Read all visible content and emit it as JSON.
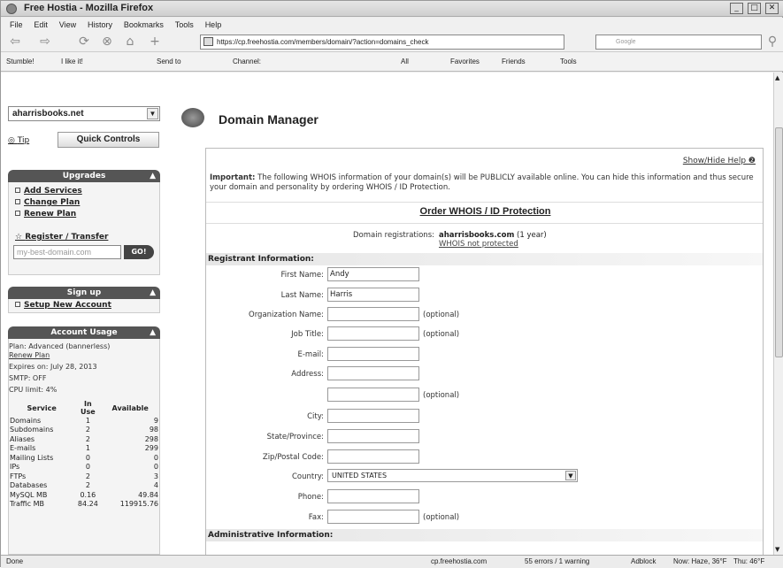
{
  "window": {
    "title": "Free Hostia - Mozilla Firefox"
  },
  "menu": [
    "File",
    "Edit",
    "View",
    "History",
    "Bookmarks",
    "Tools",
    "Help"
  ],
  "nav": {
    "url": "https://cp.freehostia.com/members/domain/?action=domains_check",
    "search_placeholder": "Google"
  },
  "toolbar": {
    "stumble": "Stumble!",
    "ilike": "I like it!",
    "sendto": "Send to",
    "channel": "Channel:",
    "all": "All",
    "favorites": "Favorites",
    "friends": "Friends",
    "tools": "Tools"
  },
  "sidebar": {
    "domain": "aharrisbooks.net",
    "tip": "Tip",
    "quick_controls": "Quick Controls",
    "upgrades": {
      "title": "Upgrades",
      "items": [
        "Add Services",
        "Change Plan",
        "Renew Plan"
      ]
    },
    "register": "Register / Transfer",
    "domain_placeholder": "my-best-domain.com",
    "go": "GO!",
    "signup": {
      "title": "Sign up",
      "items": [
        "Setup New Account"
      ]
    },
    "account": {
      "title": "Account Usage",
      "plan": "Plan: Advanced (bannerless)",
      "renew": "Renew Plan",
      "expires": "Expires on: July 28, 2013",
      "smtp": "SMTP: OFF",
      "cpu": "CPU limit: 4%",
      "headers": [
        "Service",
        "In Use",
        "Available"
      ],
      "rows": [
        [
          "Domains",
          "1",
          "9"
        ],
        [
          "Subdomains",
          "2",
          "98"
        ],
        [
          "Aliases",
          "2",
          "298"
        ],
        [
          "E-mails",
          "1",
          "299"
        ],
        [
          "Mailing Lists",
          "0",
          "0"
        ],
        [
          "IPs",
          "0",
          "0"
        ],
        [
          "FTPs",
          "2",
          "3"
        ],
        [
          "Databases",
          "2",
          "4"
        ],
        [
          "MySQL MB",
          "0.16",
          "49.84"
        ],
        [
          "Traffic MB",
          "84.24",
          "119915.76"
        ]
      ]
    }
  },
  "main": {
    "title": "Domain Manager",
    "show_hide_help": "Show/Hide Help",
    "important_bold": "Important:",
    "important_text": " The following WHOIS information of your domain(s) will be PUBLICLY available online. You can hide this information and thus secure your domain and personality by ordering WHOIS / ID Protection.",
    "order_link": "Order WHOIS / ID Protection",
    "registrations_label": "Domain registrations:",
    "registration_domain": "aharrisbooks.com",
    "registration_period": " (1 year)",
    "whois_status": "WHOIS not protected",
    "registrant_section": "Registrant Information:",
    "admin_section": "Administrative Information:",
    "optional": "(optional)",
    "fields": {
      "first_name": {
        "label": "First Name:",
        "value": "Andy"
      },
      "last_name": {
        "label": "Last Name:",
        "value": "Harris"
      },
      "organization": {
        "label": "Organization Name:",
        "value": ""
      },
      "job_title": {
        "label": "Job Title:",
        "value": ""
      },
      "email": {
        "label": "E-mail:",
        "value": ""
      },
      "address": {
        "label": "Address:",
        "value": ""
      },
      "city": {
        "label": "City:",
        "value": ""
      },
      "state": {
        "label": "State/Province:",
        "value": ""
      },
      "zip": {
        "label": "Zip/Postal Code:",
        "value": ""
      },
      "country": {
        "label": "Country:",
        "value": "UNITED STATES"
      },
      "phone": {
        "label": "Phone:",
        "value": ""
      },
      "fax": {
        "label": "Fax:",
        "value": ""
      }
    }
  },
  "status": {
    "done": "Done",
    "host": "cp.freehostia.com",
    "errors": "55 errors / 1 warning",
    "adblock": "Adblock",
    "now": "Now: Haze, 36°F",
    "thu": "Thu: 46°F",
    "fri": "Fri: 48°F"
  }
}
